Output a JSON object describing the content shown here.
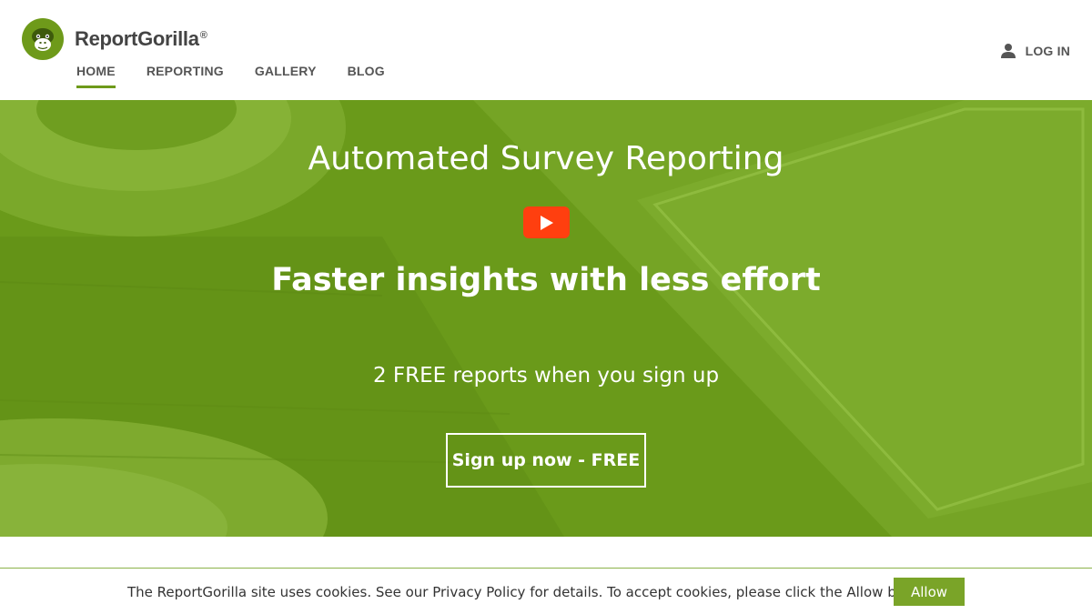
{
  "brand": {
    "name": "ReportGorilla",
    "registered_mark": "®",
    "accent_color": "#6e9a1a"
  },
  "nav": {
    "items": [
      {
        "label": "HOME",
        "active": true
      },
      {
        "label": "REPORTING",
        "active": false
      },
      {
        "label": "GALLERY",
        "active": false
      },
      {
        "label": "BLOG",
        "active": false
      }
    ]
  },
  "header": {
    "login_label": "LOG IN",
    "login_icon": "user-icon"
  },
  "hero": {
    "title": "Automated Survey Reporting",
    "play_icon": "play-icon",
    "play_color": "#ff3f0f",
    "subtitle": "Faster insights with less effort",
    "offer": "2 FREE reports when you sign up",
    "cta_label": "Sign up now - FREE",
    "background_color": "#6a9a1a"
  },
  "cookie_bar": {
    "message": "The ReportGorilla site uses cookies. See our Privacy Policy for details. To accept cookies, please click the Allow button.",
    "allow_label": "Allow"
  }
}
